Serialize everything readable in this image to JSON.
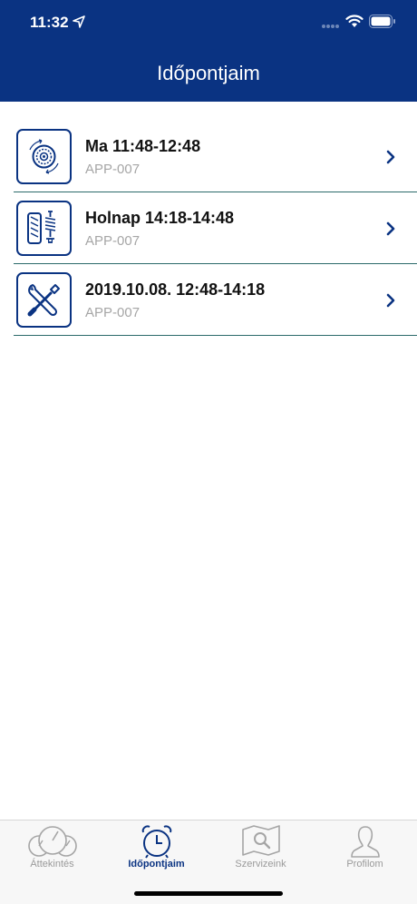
{
  "status": {
    "time": "11:32"
  },
  "header": {
    "title": "Időpontjaim"
  },
  "appointments": [
    {
      "title": "Ma 11:48-12:48",
      "code": "APP-007",
      "icon": "tire-rotation-icon"
    },
    {
      "title": "Holnap 14:18-14:48",
      "code": "APP-007",
      "icon": "tire-suspension-icon"
    },
    {
      "title": "2019.10.08. 12:48-14:18",
      "code": "APP-007",
      "icon": "wrench-screwdriver-icon"
    }
  ],
  "tabs": [
    {
      "label": "Áttekintés",
      "icon": "gauges-icon",
      "active": false
    },
    {
      "label": "Időpontjaim",
      "icon": "alarm-clock-icon",
      "active": true
    },
    {
      "label": "Szervizeink",
      "icon": "map-search-icon",
      "active": false
    },
    {
      "label": "Profilom",
      "icon": "person-icon",
      "active": false
    }
  ],
  "colors": {
    "primary": "#0a3382",
    "divider": "#2b6a6a",
    "muted": "#a6a6a6",
    "tab_inactive": "#9a9a9a"
  }
}
